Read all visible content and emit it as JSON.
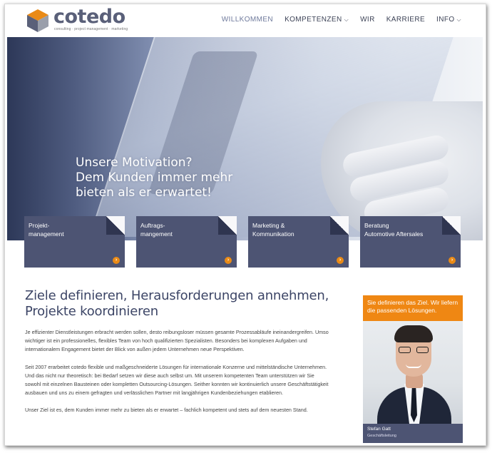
{
  "brand": {
    "name": "cotedo",
    "tagline": "consulting · project management · marketing",
    "colors": {
      "orange": "#e98a16",
      "slate": "#4d5473",
      "gray_cube": "#8a8f9c"
    }
  },
  "nav": {
    "items": [
      {
        "label": "WILLKOMMEN",
        "active": true,
        "has_dropdown": false
      },
      {
        "label": "KOMPETENZEN",
        "active": false,
        "has_dropdown": true
      },
      {
        "label": "WIR",
        "active": false,
        "has_dropdown": false
      },
      {
        "label": "KARRIERE",
        "active": false,
        "has_dropdown": false
      },
      {
        "label": "INFO",
        "active": false,
        "has_dropdown": true
      }
    ],
    "dropdown_icon": "chevron-down-icon"
  },
  "hero": {
    "lines": [
      "Unsere Motivation?",
      "Dem Kunden immer mehr",
      "bieten als er erwartet!"
    ]
  },
  "services": [
    {
      "line1": "Projekt-",
      "line2": "management",
      "icon": "arrow-right-circle-icon"
    },
    {
      "line1": "Auftrags-",
      "line2": "mangement",
      "icon": "arrow-right-circle-icon"
    },
    {
      "line1": "Marketing &",
      "line2": "Kommunikation",
      "icon": "arrow-right-circle-icon"
    },
    {
      "line1": "Beratung",
      "line2": "Automotive Aftersales",
      "icon": "arrow-right-circle-icon"
    }
  ],
  "content": {
    "headline": "Ziele definieren, Herausforderungen annehmen, Projekte koordinieren",
    "paragraphs": [
      "Je effizienter Dienstleistungen erbracht werden sollen, desto reibungsloser müssen gesamte Prozessabläufe ineinandergreifen. Umso wichtiger ist ein professionelles, flexibles Team von hoch qualifizierten Spezialisten. Besonders bei komplexen Aufgaben und internationalem Engagement bietet der Blick von außen jedem Unternehmen neue Perspektiven.",
      "Seit 2007 erarbeitet cotedo flexible und maßgeschneiderte Lösungen für internationale Konzerne und mittelständische Unternehmen. Und das nicht nur theoretisch: bei Bedarf setzen wir diese auch selbst um. Mit unserem kompetenten Team unterstützen wir Sie sowohl mit einzelnen Bausteinen oder kompletten Outsourcing-Lösungen. Seither konnten wir kontinuierlich unsere Geschäftstätigkeit ausbauen und uns zu einem gefragten und verlässlichen Partner mit langjährigen Kundenbeziehungen etablieren.",
      "Unser Ziel ist es, dem Kunden immer mehr zu bieten als er erwartet – fachlich kompetent und stets auf dem neuesten Stand."
    ]
  },
  "sidebar": {
    "heading": "Sie definieren das Ziel. Wir liefern die passenden Lösungen.",
    "person_name": "Stefan Gatt",
    "person_role": "Geschäftsleitung"
  }
}
